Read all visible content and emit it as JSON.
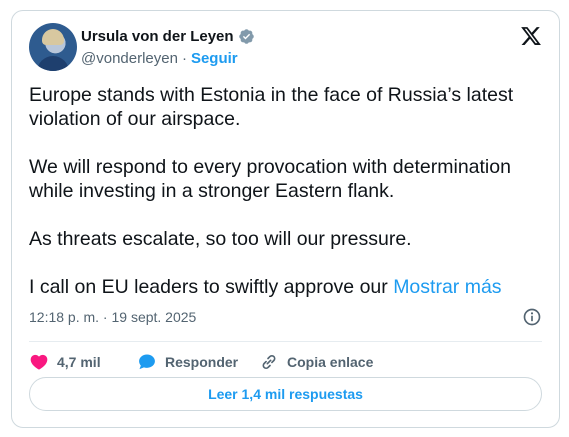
{
  "author": {
    "display_name": "Ursula von der Leyen",
    "handle": "@vonderleyen",
    "separator": "·",
    "follow_label": "Seguir"
  },
  "icons": {
    "verified": "verified-badge-icon",
    "x_logo": "x-logo-icon",
    "info": "info-icon",
    "like": "heart-icon",
    "reply": "reply-bubble-icon",
    "copy_link": "link-icon"
  },
  "tweet": {
    "paragraphs": [
      "Europe stands with Estonia in the face of Russia’s latest violation of our airspace.",
      "We will respond to every provocation with determination while investing in a stronger Eastern flank.",
      "As threats escalate, so too will our pressure."
    ],
    "last_line": "I call on EU leaders to swiftly approve our",
    "show_more": "Mostrar más",
    "timestamp": "12:18 p. m. · 19 sept. 2025"
  },
  "actions": {
    "like_count": "4,7 mil",
    "reply_label": "Responder",
    "copy_label": "Copia enlace"
  },
  "replies_button": "Leer 1,4 mil respuestas",
  "colors": {
    "accent": "#1d9bf0",
    "like": "#f91880",
    "text": "#0f1419",
    "muted": "#536471",
    "border": "#cfd9de"
  }
}
